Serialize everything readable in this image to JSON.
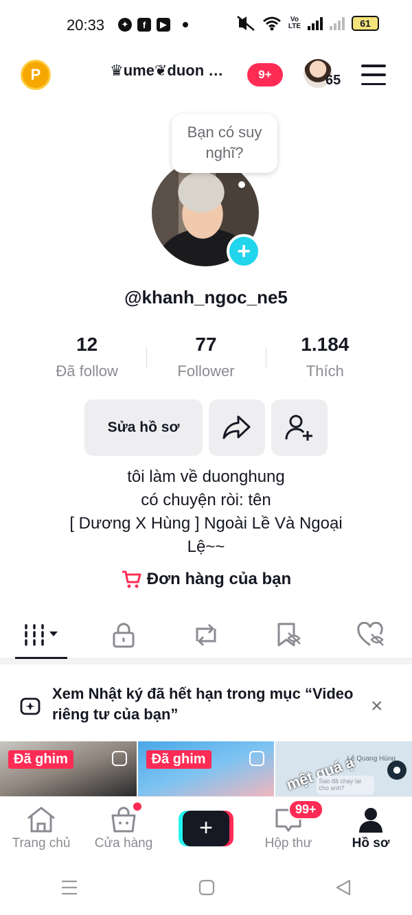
{
  "status_bar": {
    "time": "20:33",
    "volte": "Vo\nLTE",
    "battery": "61"
  },
  "top_nav": {
    "coin_label": "P",
    "username": "♛ume❦duon …",
    "notif_badge": "9+",
    "avatar_count": "65"
  },
  "profile": {
    "thought_bubble": "Bạn có suy nghĩ?",
    "handle": "@khanh_ngoc_ne5",
    "stats": [
      {
        "value": "12",
        "label": "Đã follow"
      },
      {
        "value": "77",
        "label": "Follower"
      },
      {
        "value": "1.184",
        "label": "Thích"
      }
    ],
    "edit_button": "Sửa hồ sơ",
    "bio_lines": [
      "tôi làm về duonghung",
      "có chuyện ròi: tên",
      "[ Dương X Hùng ] Ngoài Lề Và Ngoại",
      "Lệ~~"
    ],
    "orders_label": "Đơn hàng của bạn"
  },
  "notice": {
    "text": "Xem Nhật ký đã hết hạn trong mục “Video riêng tư của bạn”",
    "close": "×"
  },
  "grid": {
    "pinned_label": "Đã ghim",
    "thumb3_overlay": "mệt quá ạ",
    "thumb3_name": "Lê Quang Hùng",
    "thumb3_msg": "Sao đã chạy lại cho anh?"
  },
  "bottom_nav": {
    "items": [
      {
        "label": "Trang chủ"
      },
      {
        "label": "Cửa hàng"
      },
      {
        "label": ""
      },
      {
        "label": "Hộp thư",
        "badge": "99+"
      },
      {
        "label": "Hồ sơ"
      }
    ]
  },
  "colors": {
    "accent": "#fe2c55",
    "cyan": "#20d5ec",
    "text": "#161823",
    "muted": "#8a8b91"
  }
}
